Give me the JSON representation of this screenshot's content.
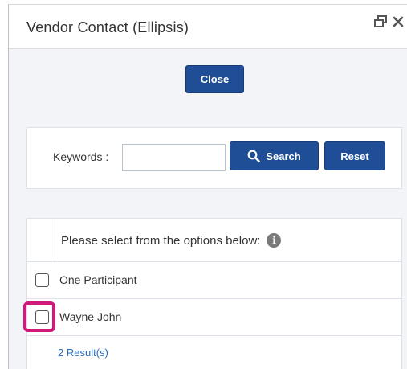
{
  "window": {
    "title": "Vendor Contact (Ellipsis)",
    "icons": [
      "restore-window-icon",
      "close-window-icon"
    ]
  },
  "actions": {
    "close_label": "Close"
  },
  "search": {
    "keywords_label": "Keywords :",
    "keywords_value": "",
    "search_label": "Search",
    "reset_label": "Reset"
  },
  "results": {
    "header": "Please select from the options below:",
    "info_glyph": "i",
    "rows": [
      {
        "label": "One Participant",
        "checked": false
      },
      {
        "label": "Wayne John",
        "checked": false
      }
    ],
    "count": "2 Result(s)"
  },
  "colors": {
    "button": "#1f4e96",
    "highlight": "#d0197a",
    "link": "#2a6ebb",
    "panel_bg": "#f2f4f8"
  }
}
